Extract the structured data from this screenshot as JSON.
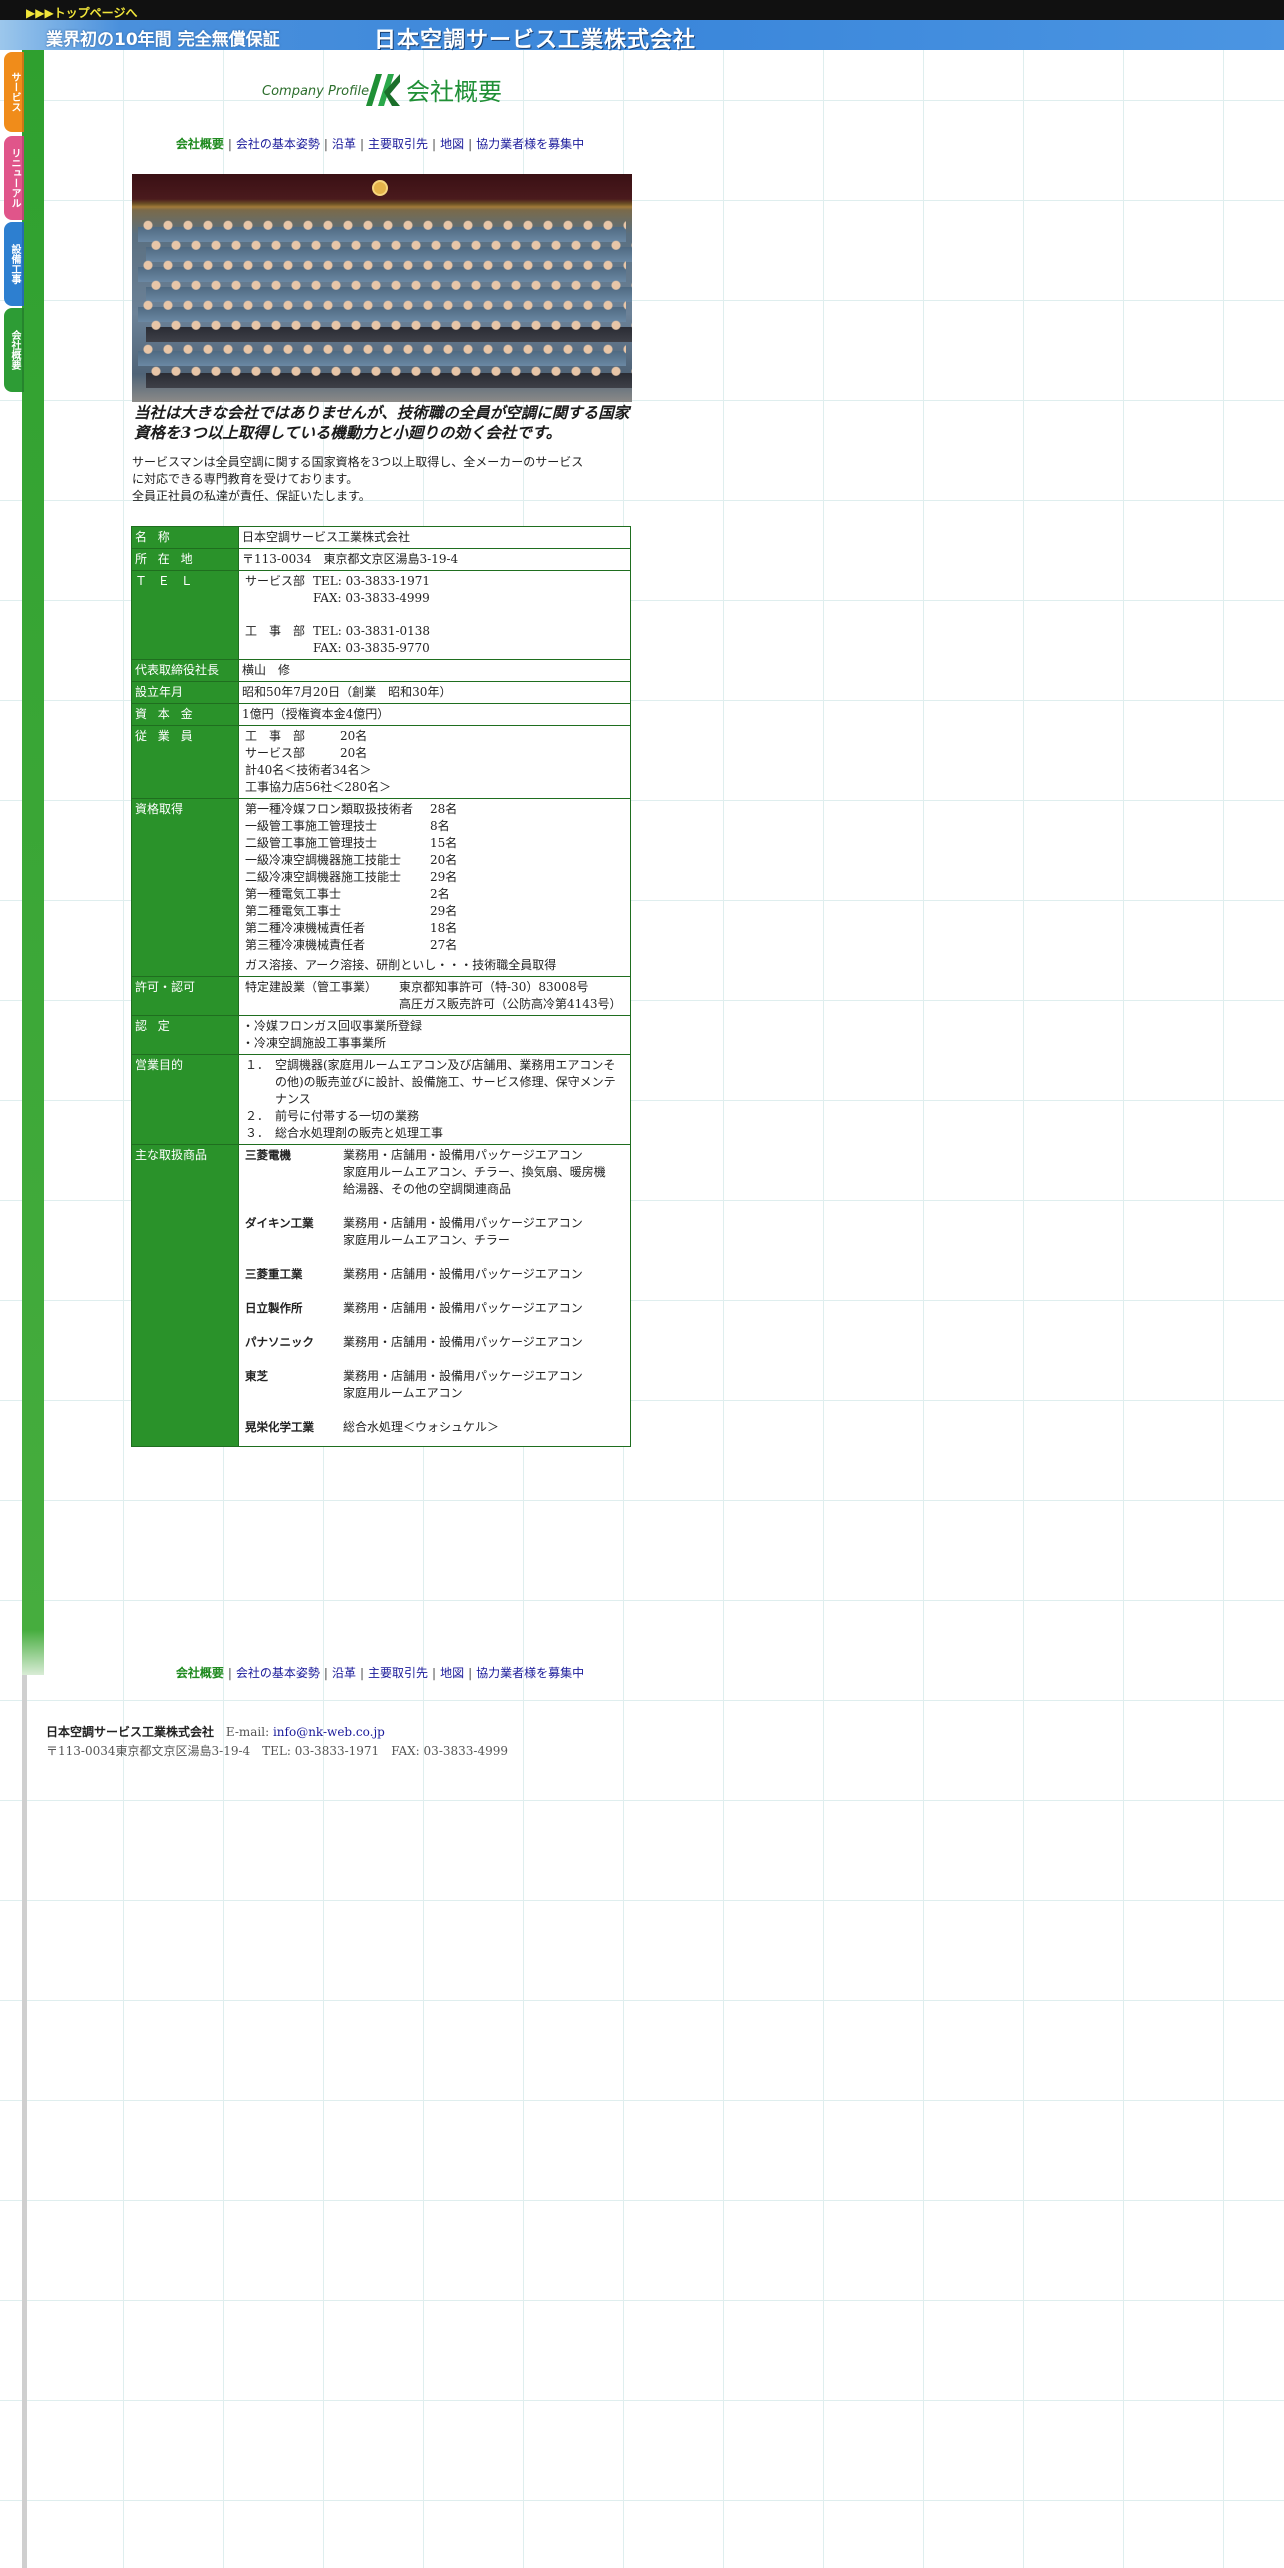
{
  "top_link": "▶▶▶トップページへ",
  "banner": {
    "slogan": "業界初の10年間 完全無償保証",
    "company_logo": "日本空調サービス工業株式会社"
  },
  "side_tabs": [
    "サービス",
    "リニューアル",
    "設備工事",
    "会社概要"
  ],
  "title": {
    "en": "Company Profile",
    "ja": "会社概要"
  },
  "nav": {
    "current": "会社概要",
    "links": [
      "会社の基本姿勢",
      "沿革",
      "主要取引先",
      "地図",
      "協力業者様を募集中"
    ]
  },
  "headline": "当社は大きな会社ではありませんが、技術職の全員が空調に関する国家資格を3つ以上取得している機動力と小廻りの効く会社です。",
  "intro": [
    "サービスマンは全員空調に関する国家資格を3つ以上取得し、全メーカーのサービス",
    "に対応できる専門教育を受けております。",
    "全員正社員の私達が責任、保証いたします。"
  ],
  "table": {
    "company_label": "名称",
    "company": "日本空調サービス工業株式会社",
    "address_label": "所在地",
    "address": "〒113-0034　東京都文京区湯島3-19-4",
    "tel_label": "ＴＥＬ",
    "tel": [
      {
        "dept": "サービス部",
        "tel": "TEL: 03-3833-1971",
        "fax": "FAX: 03-3833-4999"
      },
      {
        "dept": "工　事　部",
        "tel": "TEL: 03-3831-0138",
        "fax": "FAX: 03-3835-9770"
      }
    ],
    "ceo_label": "代表取締役社長",
    "ceo": "横山　修",
    "founded_label": "設立年月",
    "founded": "昭和50年7月20日（創業　昭和30年）",
    "capital_label": "資本金",
    "capital": "1億円（授権資本金4億円）",
    "employees_label": "従業員",
    "employees": [
      {
        "dept": "工　事　部",
        "count": "20名"
      },
      {
        "dept": "サービス部",
        "count": "20名"
      }
    ],
    "employees_total": "計40名＜技術者34名＞",
    "employees_partners": "工事協力店56社＜280名＞",
    "qual_label": "資格取得",
    "qualifications": [
      {
        "name": "第一種冷媒フロン類取扱技術者",
        "count": "28名"
      },
      {
        "name": "一級管工事施工管理技士",
        "count": "8名"
      },
      {
        "name": "二級管工事施工管理技士",
        "count": "15名"
      },
      {
        "name": "一級冷凍空調機器施工技能士",
        "count": "20名"
      },
      {
        "name": "二級冷凍空調機器施工技能士",
        "count": "29名"
      },
      {
        "name": "第一種電気工事士",
        "count": "2名"
      },
      {
        "name": "第二種電気工事士",
        "count": "29名"
      },
      {
        "name": "第二種冷凍機械責任者",
        "count": "18名"
      },
      {
        "name": "第三種冷凍機械責任者",
        "count": "27名"
      }
    ],
    "qual_note": "ガス溶接、アーク溶接、研削といし・・・技術職全員取得",
    "license_label": "許可・認可",
    "license_type": "特定建設業（管工事業）",
    "license_items": [
      "東京都知事許可（特-30）83008号",
      "高圧ガス販売許可（公防高冷第4143号）"
    ],
    "cert_label": "認定",
    "certs": [
      "・冷媒フロンガス回収事業所登録",
      "・冷凍空調施設工事事業所"
    ],
    "purpose_label": "営業目的",
    "purposes": [
      {
        "no": "１．",
        "text": "空調機器(家庭用ルームエアコン及び店舗用、業務用エアコンその他)の販売並びに設計、設備施工、サービス修理、保守メンテナンス"
      },
      {
        "no": "２．",
        "text": "前号に付帯する一切の業務"
      },
      {
        "no": "３．",
        "text": "総合水処理剤の販売と処理工事"
      }
    ],
    "products_label": "主な取扱商品",
    "products": [
      {
        "maker": "三菱電機",
        "lines": [
          "業務用・店舗用・設備用パッケージエアコン",
          "家庭用ルームエアコン、チラー、換気扇、暖房機",
          "給湯器、その他の空調関連商品"
        ]
      },
      {
        "maker": "ダイキン工業",
        "lines": [
          "業務用・店舗用・設備用パッケージエアコン",
          "家庭用ルームエアコン、チラー"
        ]
      },
      {
        "maker": "三菱重工業",
        "lines": [
          "業務用・店舗用・設備用パッケージエアコン"
        ]
      },
      {
        "maker": "日立製作所",
        "lines": [
          "業務用・店舗用・設備用パッケージエアコン"
        ]
      },
      {
        "maker": "パナソニック",
        "lines": [
          "業務用・店舗用・設備用パッケージエアコン"
        ]
      },
      {
        "maker": "東芝",
        "lines": [
          "業務用・店舗用・設備用パッケージエアコン",
          "家庭用ルームエアコン"
        ]
      },
      {
        "maker": "晃栄化学工業",
        "lines": [
          "総合水処理＜ウォシュケル＞"
        ]
      }
    ]
  },
  "footer": {
    "company": "日本空調サービス工業株式会社",
    "email_label": "E-mail:",
    "email": "info@nk-web.co.jp",
    "address": "〒113-0034東京都文京区湯島3-19-4　TEL: 03-3833-1971　FAX: 03-3833-4999"
  },
  "colors": {
    "table_header": "#2a922a",
    "banner": "#3a86da",
    "link": "#1a1a9a",
    "current": "#1f8a1f"
  }
}
